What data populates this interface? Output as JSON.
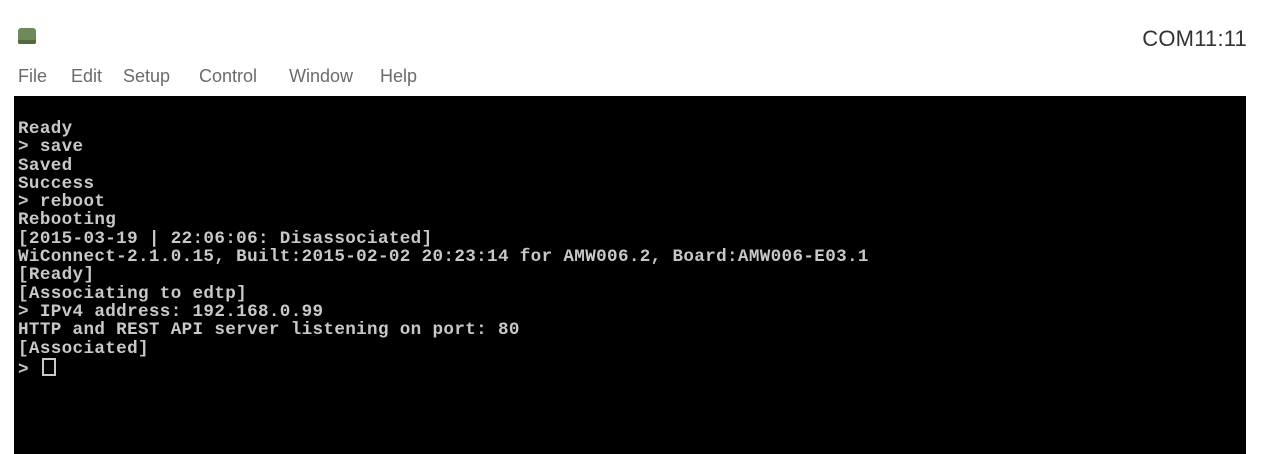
{
  "window": {
    "title": "COM11:11",
    "icon": "serial-terminal-app-icon"
  },
  "menu": [
    {
      "label": "File"
    },
    {
      "label": "Edit"
    },
    {
      "label": "Setup"
    },
    {
      "label": "Control"
    },
    {
      "label": "Window"
    },
    {
      "label": "Help"
    }
  ],
  "terminal": {
    "colors": {
      "background": "#000000",
      "text": "#c8c8c8"
    },
    "lines": [
      "Ready",
      "> save",
      "Saved",
      "Success",
      "> reboot",
      "Rebooting",
      "[2015-03-19 | 22:06:06: Disassociated]",
      "WiConnect-2.1.0.15, Built:2015-02-02 20:23:14 for AMW006.2, Board:AMW006-E03.1",
      "[Ready]",
      "[Associating to edtp]",
      "> IPv4 address: 192.168.0.99",
      "HTTP and REST API server listening on port: 80",
      "[Associated]",
      "> "
    ]
  }
}
